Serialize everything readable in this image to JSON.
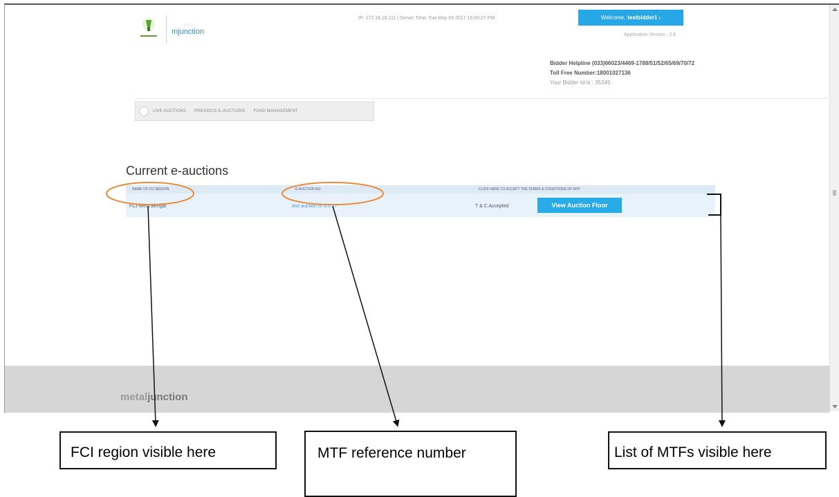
{
  "header": {
    "mjunction_logo_text": "mjunction",
    "ip_info": "IP: 172.16.16.111 | Server Time: Tue May 09 2017 15:00:27 PM",
    "welcome_label": "Welcome,",
    "welcome_user": "testbidder1 ›",
    "app_version": "Application Version : 2.8",
    "helpline": "Bidder Helpline (033)66023/4469-1788/51/52/65/69/70/72",
    "tollfree": "Toll Free Number:18001027136",
    "bidder_id": "Your Bidder Id is : 35349"
  },
  "nav": {
    "items": [
      "LIVE AUCTIONS",
      "PREVIOUS E-AUCTIONS",
      "FUND MANAGEMENT"
    ]
  },
  "main": {
    "section_title": "Current e-auctions",
    "columns": [
      "NAME OF FCI REGION",
      "E-AUCTION NO.",
      "CLICK HERE TO ACCEPT THE TERMS & CONDITIONS OF MTF"
    ],
    "rows": [
      {
        "region": "FCI-West Bengal",
        "auction_no": "test auction re 9.5.17",
        "tc_status": "T & C Accepted",
        "action": "View Auction Floor"
      }
    ]
  },
  "footer": {
    "logo_prefix": "metal",
    "logo_suffix": "junction"
  },
  "annotations": {
    "box1": "FCI region visible here",
    "box2": "MTF reference number",
    "box3": "List of MTFs visible here"
  },
  "colors": {
    "accent": "#27a7e6",
    "highlight_circle": "#e98b3a",
    "footer_bg": "#d6d6d6",
    "row_bg": "#e8f2fa"
  },
  "icons": [
    "fci-logo-icon",
    "home-icon",
    "scroll-up-icon",
    "scroll-down-icon"
  ]
}
